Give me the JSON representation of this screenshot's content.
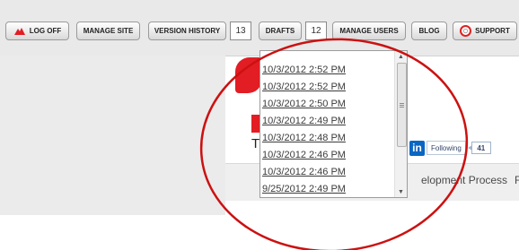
{
  "toolbar": {
    "log_off_label": "LOG OFF",
    "manage_site_label": "MANAGE SITE",
    "version_history_label": "VERSION HISTORY",
    "version_history_count": "13",
    "drafts_label": "DRAFTS",
    "drafts_count": "12",
    "manage_users_label": "MANAGE USERS",
    "blog_label": "BLOG",
    "support_label": "SUPPORT"
  },
  "version_dropdown": {
    "items": [
      "10/3/2012 2:52 PM",
      "10/3/2012 2:52 PM",
      "10/3/2012 2:50 PM",
      "10/3/2012 2:49 PM",
      "10/3/2012 2:48 PM",
      "10/3/2012 2:46 PM",
      "10/3/2012 2:46 PM",
      "9/25/2012 2:49 PM"
    ]
  },
  "page": {
    "logo_letter": "T",
    "linkedin_icon": "in",
    "linkedin_follow_label": "Following",
    "linkedin_follower_count": "41",
    "nav_item": "elopment Process",
    "nav_item_next": "F"
  },
  "colors": {
    "brand_red": "#e21d24",
    "annotation_red": "#cc1111",
    "linkedin_blue": "#0a66c2"
  },
  "icons": {
    "log_off": "logoff-icon",
    "support": "lifebuoy-icon",
    "scroll_up": "scroll-up-arrow-icon",
    "scroll_down": "scroll-down-arrow-icon"
  }
}
